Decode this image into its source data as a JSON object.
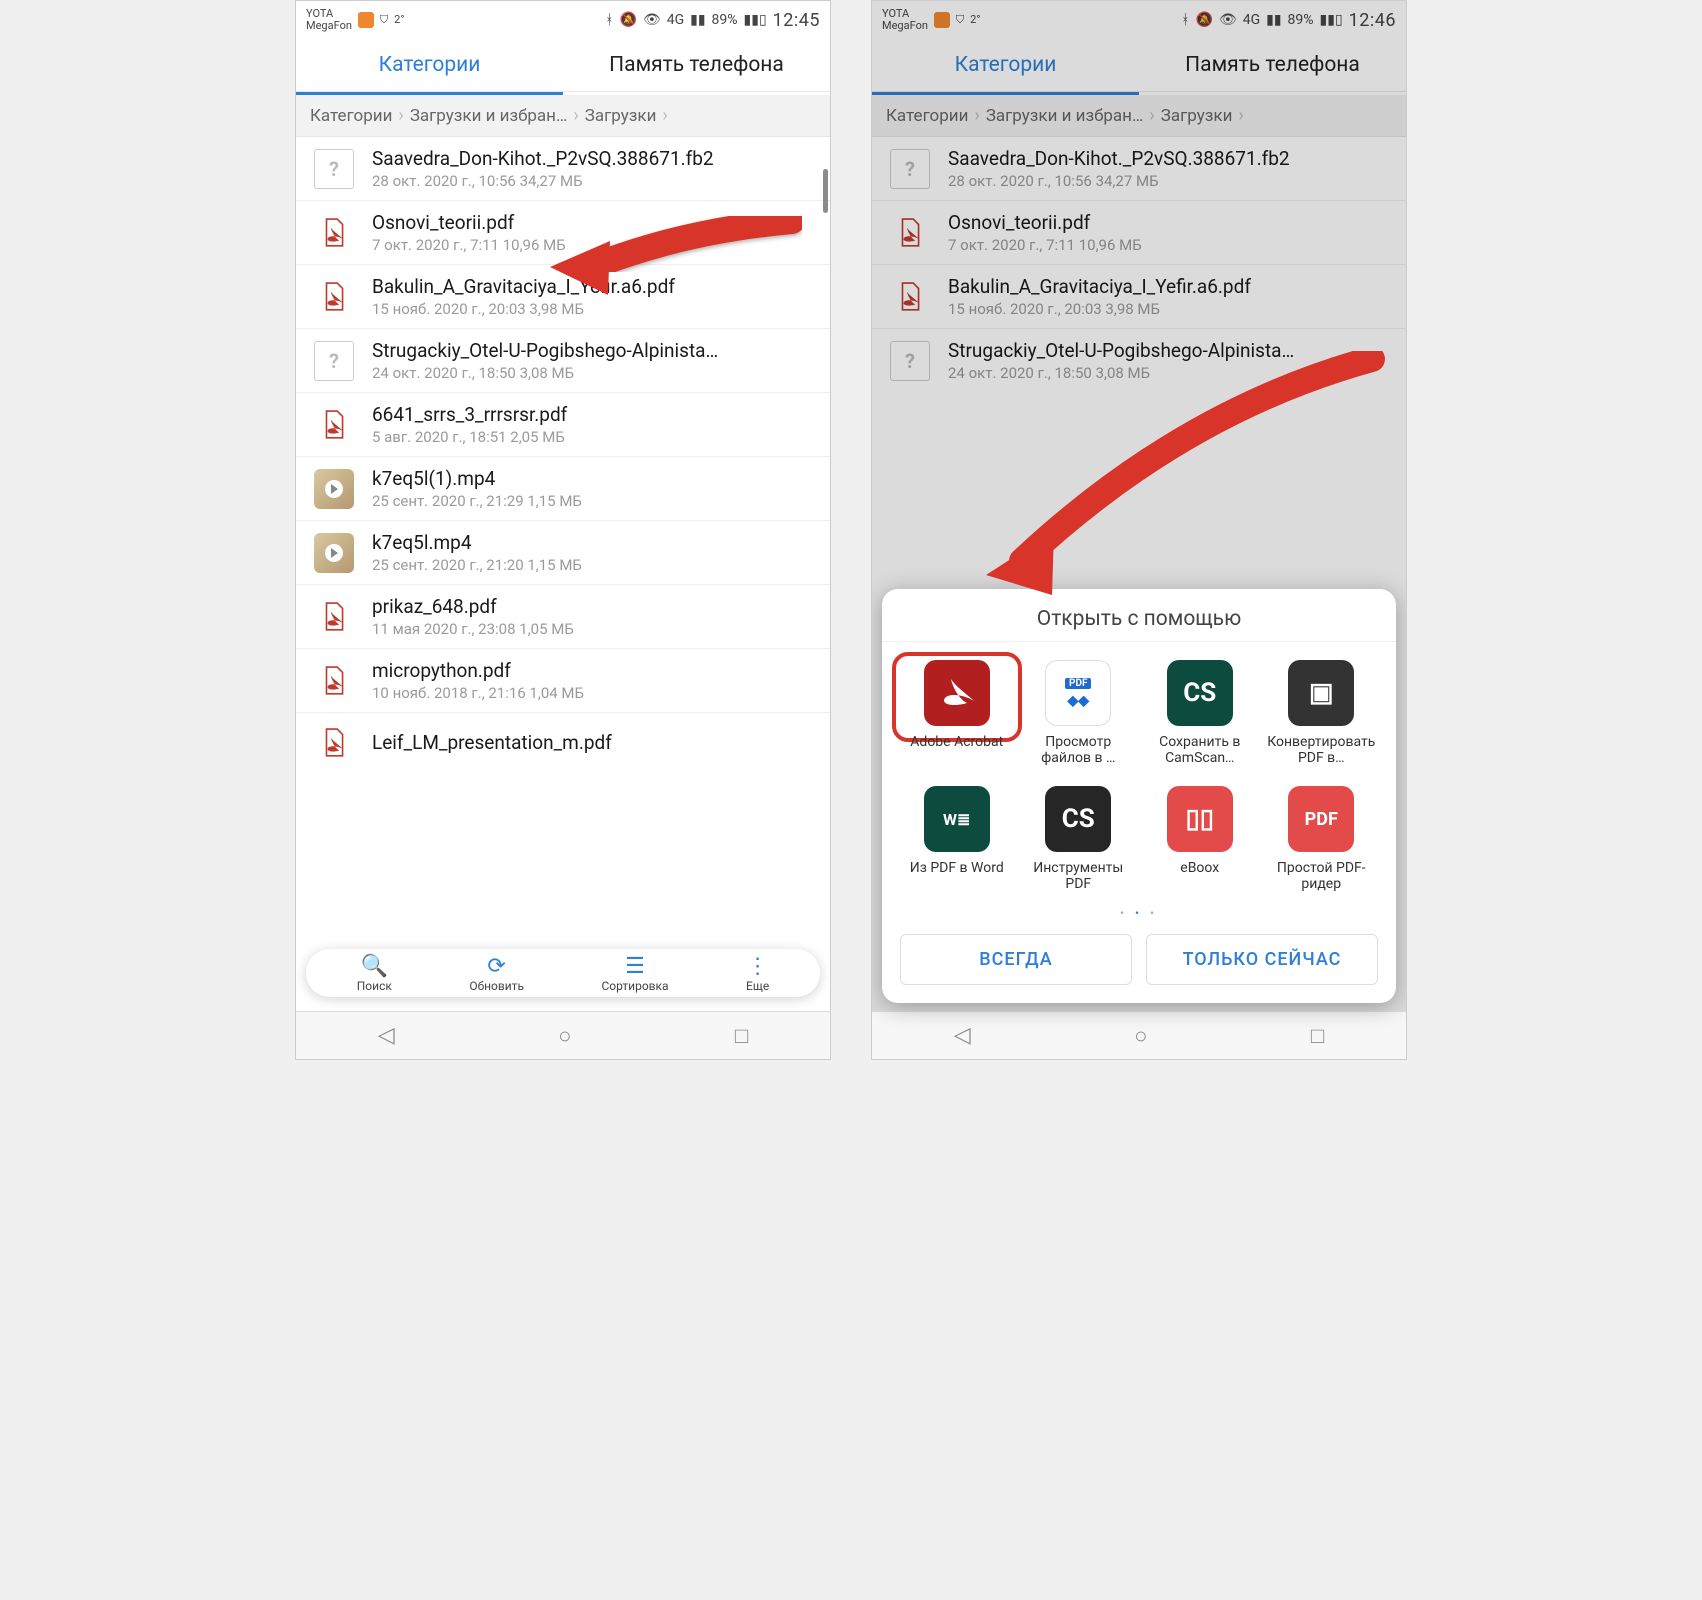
{
  "status": {
    "carrier1": "YOTA",
    "carrier2": "MegaFon",
    "temp": "2°",
    "batteryPct": "89%",
    "time_left": "12:45",
    "time_right": "12:46",
    "net": "4G"
  },
  "tabs": {
    "categories": "Категории",
    "memory": "Память телефона"
  },
  "breadcrumbs": {
    "a": "Категории",
    "b": "Загрузки и избран…",
    "c": "Загрузки"
  },
  "files": [
    {
      "name": "Saavedra_Don-Kihot._P2vSQ.388671.fb2",
      "meta": "28 окт. 2020 г., 10:56 34,27 МБ",
      "type": "unknown"
    },
    {
      "name": "Osnovi_teorii.pdf",
      "meta": "7 окт. 2020 г., 7:11 10,96 МБ",
      "type": "pdf"
    },
    {
      "name": "Bakulin_A_Gravitaciya_I_Yefir.a6.pdf",
      "meta": "15 нояб. 2020 г., 20:03 3,98 МБ",
      "type": "pdf"
    },
    {
      "name": "Strugackiy_Otel-U-Pogibshego-Alpinista…",
      "meta": "24 окт. 2020 г., 18:50 3,08 МБ",
      "type": "unknown"
    },
    {
      "name": "6641_srrs_3_rrrsrsr.pdf",
      "meta": "5 авг. 2020 г., 18:51 2,05 МБ",
      "type": "pdf"
    },
    {
      "name": "k7eq5l(1).mp4",
      "meta": "25 сент. 2020 г., 21:29 1,15 МБ",
      "type": "video"
    },
    {
      "name": "k7eq5l.mp4",
      "meta": "25 сент. 2020 г., 21:20 1,15 МБ",
      "type": "video"
    },
    {
      "name": "prikaz_648.pdf",
      "meta": "11 мая 2020 г., 23:08 1,05 МБ",
      "type": "pdf"
    },
    {
      "name": "micropython.pdf",
      "meta": "10 нояб. 2018 г., 21:16 1,04 МБ",
      "type": "pdf"
    },
    {
      "name": "Leif_LM_presentation_m.pdf",
      "meta": "",
      "type": "pdf"
    }
  ],
  "pill": {
    "search": "Поиск",
    "refresh": "Обновить",
    "sort": "Сортировка",
    "more": "Еще"
  },
  "sheet": {
    "title": "Открыть с помощью",
    "apps": [
      {
        "label": "Adobe Acrobat",
        "icon": "acrobat"
      },
      {
        "label": "Просмотр файлов в …",
        "icon": "dropbox"
      },
      {
        "label": "Сохранить в CamScan…",
        "icon": "cs"
      },
      {
        "label": "Конвертировать PDF в…",
        "icon": "conv"
      },
      {
        "label": "Из PDF в Word",
        "icon": "word"
      },
      {
        "label": "Инструменты PDF",
        "icon": "cs2"
      },
      {
        "label": "eBoox",
        "icon": "eboox"
      },
      {
        "label": "Простой PDF-ридер",
        "icon": "pdfred"
      }
    ],
    "always": "ВСЕГДА",
    "justOnce": "ТОЛЬКО СЕЙЧАС"
  }
}
